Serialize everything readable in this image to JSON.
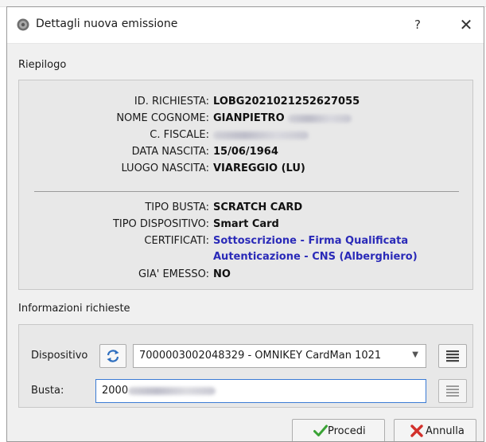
{
  "window": {
    "title": "Dettagli nuova emissione",
    "help_label": "?",
    "close_label": "✕"
  },
  "summary": {
    "section_label": "Riepilogo",
    "fields": [
      {
        "label": "ID. RICHIESTA:",
        "value": "LOBG2021021252627055"
      },
      {
        "label": "NOME COGNOME:",
        "value": "GIANPIETRO"
      },
      {
        "label": "C. FISCALE:",
        "value": ""
      },
      {
        "label": "DATA NASCITA:",
        "value": "15/06/1964"
      },
      {
        "label": "LUOGO NASCITA:",
        "value": "VIAREGGIO (LU)"
      },
      {
        "label": "TIPO BUSTA:",
        "value": "SCRATCH CARD"
      },
      {
        "label": "TIPO DISPOSITIVO:",
        "value": "Smart Card"
      },
      {
        "label": "CERTIFICATI:",
        "value": "Sottoscrizione - Firma Qualificata",
        "value_line2": "Autenticazione - CNS (Alberghiero)"
      },
      {
        "label": "GIA' EMESSO:",
        "value": "NO"
      }
    ]
  },
  "info": {
    "section_label": "Informazioni richieste",
    "device_label": "Dispositivo",
    "device_selected": "7000003002048329 - OMNIKEY CardMan 1021",
    "busta_label": "Busta:",
    "busta_value": "2000"
  },
  "actions": {
    "proceed_label": "Procedi",
    "cancel_label": "Annulla"
  },
  "colors": {
    "accent": "#3b7bd4",
    "certificati_text": "#2a2ab8",
    "refresh_icon": "#2f6fbf",
    "check_icon": "#3aa335",
    "cancel_icon": "#d2302b"
  },
  "icons": {
    "app": "app-icon",
    "refresh": "refresh-icon",
    "list": "list-icon",
    "check": "check-icon",
    "cancel": "cross-icon"
  }
}
